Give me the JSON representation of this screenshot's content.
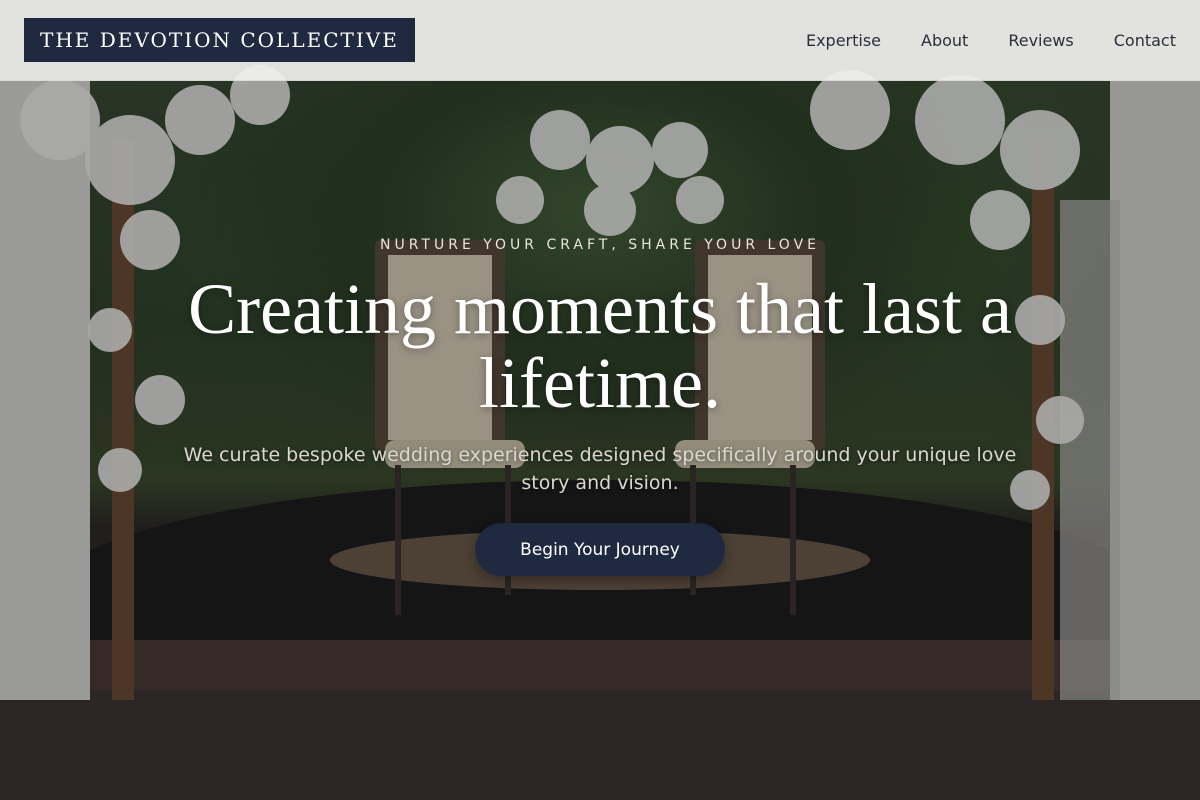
{
  "brand": {
    "name": "THE DEVOTION COLLECTIVE"
  },
  "nav": {
    "links": [
      {
        "label": "Expertise"
      },
      {
        "label": "About"
      },
      {
        "label": "Reviews"
      },
      {
        "label": "Contact"
      }
    ]
  },
  "hero": {
    "eyebrow": "NURTURE YOUR CRAFT, SHARE YOUR LOVE",
    "headline": "Creating moments that last a lifetime.",
    "subtitle": "We curate bespoke wedding experiences designed specifically around your unique love story and vision.",
    "cta_label": "Begin Your Journey",
    "image_description_icon": "wedding-arch-photo"
  },
  "colors": {
    "accent": "#1f2a40",
    "nav_background": "#f0f0ee",
    "nav_text": "#2a2f3a"
  }
}
